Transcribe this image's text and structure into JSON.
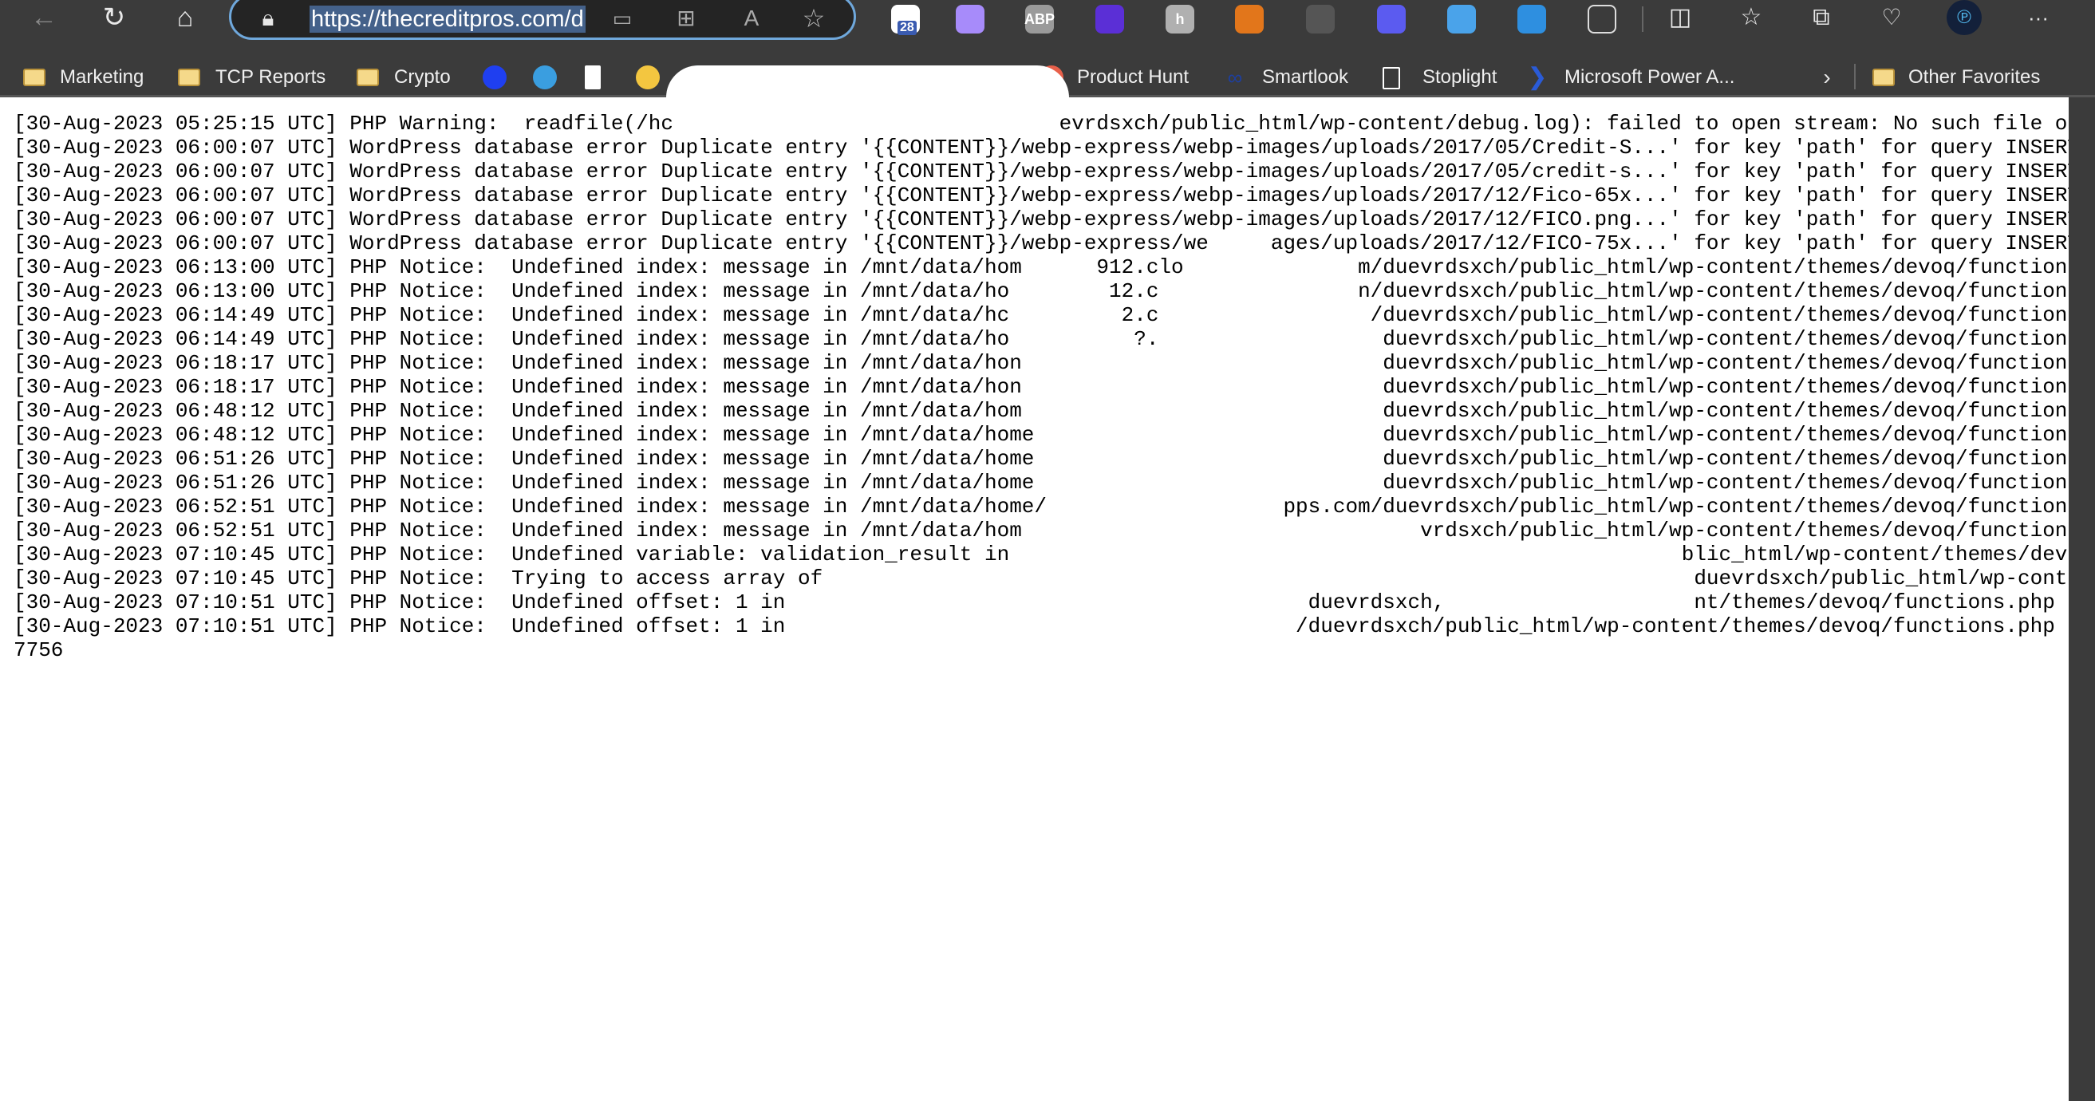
{
  "browser": {
    "url": "https://thecreditpros.com/d",
    "nav_icons": [
      "back-arrow-icon",
      "refresh-icon",
      "home-icon"
    ],
    "address_icons": [
      "lock-icon",
      "device-icon",
      "apps-icon",
      "read-aloud-icon",
      "star-icon"
    ],
    "extensions": [
      {
        "name": "calendar-icon",
        "badge": "28",
        "color": "#ffffff"
      },
      {
        "name": "ghost-icon",
        "color": "#a78bfa"
      },
      {
        "name": "adblock-plus-icon",
        "label": "ABP",
        "color": "#9a9a9a"
      },
      {
        "name": "purple-blocks-icon",
        "color": "#5b2fd6"
      },
      {
        "name": "h-icon",
        "label": "h",
        "color": "#b0b0b0"
      },
      {
        "name": "metamask-fox-icon",
        "color": "#e2761b"
      },
      {
        "name": "recycle-icon",
        "color": "#555555"
      },
      {
        "name": "blue-circle-icon",
        "color": "#5b5bf0"
      },
      {
        "name": "window-icon",
        "color": "#4aa3ea"
      },
      {
        "name": "salesforce-icon",
        "color": "#2e8fe0"
      },
      {
        "name": "puzzle-icon",
        "color": "#3b3b3b"
      }
    ],
    "right_icons": [
      "split-screen-icon",
      "favorites-icon",
      "collections-icon",
      "browser-health-icon",
      "profile-logo-icon",
      "more-icon"
    ],
    "more_label": "···"
  },
  "bookmarks": {
    "folders": [
      {
        "label": "Marketing"
      },
      {
        "label": "TCP Reports"
      },
      {
        "label": "Crypto"
      }
    ],
    "icon_links": [
      {
        "name": "bookmark-blue-circle-icon",
        "color": "#1f3ff0"
      },
      {
        "name": "bookmark-salesforce-icon",
        "color": "#3a9ee0"
      },
      {
        "name": "bookmark-t-icon",
        "color": "#ffffff"
      },
      {
        "name": "bookmark-gradient-icon",
        "color": "#f3c640"
      },
      {
        "name": "bookmark-snowflake-icon",
        "color": "#29b5e8"
      },
      {
        "name": "bookmark-bird-icon",
        "color": "#2a6fe0"
      },
      {
        "name": "bookmark-datadog-icon",
        "color": "#7b3fa0"
      },
      {
        "name": "bookmark-link-icon",
        "color": "#e8604a"
      },
      {
        "name": "bookmark-a-icon",
        "color": "#ffffff"
      }
    ],
    "links": [
      {
        "label": "Product Hunt",
        "icon": "product-hunt-icon",
        "color": "#e8604a"
      },
      {
        "label": "Smartlook",
        "icon": "smartlook-icon",
        "color": "#1d3fa0"
      },
      {
        "label": "Stoplight",
        "icon": "document-icon",
        "color": "#ffffff"
      },
      {
        "label": "Microsoft Power A...",
        "icon": "power-automate-icon",
        "color": "#2a5bd7"
      }
    ],
    "other_favorites": "Other Favorites"
  },
  "log": [
    {
      "l": "[30-Aug-2023 05:25:15 UTC] PHP Warning:  readfile(/hc",
      "r": "evrdsxch/public_html/wp-content/debug.log): failed to open stream: No such file or"
    },
    {
      "l": "[30-Aug-2023 06:00:07 UTC] WordPress database error Duplicate entry '{{CONTENT}}/webp-express/webp-images/uploads/2017/05/Credit-S...' for key 'path' for query INSERT"
    },
    {
      "l": "[30-Aug-2023 06:00:07 UTC] WordPress database error Duplicate entry '{{CONTENT}}/webp-express/webp-images/uploads/2017/05/credit-s...' for key 'path' for query INSERT"
    },
    {
      "l": "[30-Aug-2023 06:00:07 UTC] WordPress database error Duplicate entry '{{CONTENT}}/webp-express/webp-images/uploads/2017/12/Fico-65x...' for key 'path' for query INSERT"
    },
    {
      "l": "[30-Aug-2023 06:00:07 UTC] WordPress database error Duplicate entry '{{CONTENT}}/webp-express/webp-images/uploads/2017/12/FICO.png...' for key 'path' for query INSERT"
    },
    {
      "l": "[30-Aug-2023 06:00:07 UTC] WordPress database error Duplicate entry '{{CONTENT}}/webp-express/we",
      "r": "ages/uploads/2017/12/FICO-75x...' for key 'path' for query INSERT"
    },
    {
      "l": "[30-Aug-2023 06:13:00 UTC] PHP Notice:  Undefined index: message in /mnt/data/hom",
      "m": "912.clo",
      "r": "m/duevrdsxch/public_html/wp-content/themes/devoq/functions"
    },
    {
      "l": "[30-Aug-2023 06:13:00 UTC] PHP Notice:  Undefined index: message in /mnt/data/ho",
      "m": "12.c",
      "r": "n/duevrdsxch/public_html/wp-content/themes/devoq/functions"
    },
    {
      "l": "[30-Aug-2023 06:14:49 UTC] PHP Notice:  Undefined index: message in /mnt/data/hc",
      "m": "2.c",
      "r": "/duevrdsxch/public_html/wp-content/themes/devoq/functions"
    },
    {
      "l": "[30-Aug-2023 06:14:49 UTC] PHP Notice:  Undefined index: message in /mnt/data/ho",
      "m": "?.",
      "r": "duevrdsxch/public_html/wp-content/themes/devoq/functions"
    },
    {
      "l": "[30-Aug-2023 06:18:17 UTC] PHP Notice:  Undefined index: message in /mnt/data/hon",
      "r": "duevrdsxch/public_html/wp-content/themes/devoq/functions"
    },
    {
      "l": "[30-Aug-2023 06:18:17 UTC] PHP Notice:  Undefined index: message in /mnt/data/hon",
      "r": "duevrdsxch/public_html/wp-content/themes/devoq/functions"
    },
    {
      "l": "[30-Aug-2023 06:48:12 UTC] PHP Notice:  Undefined index: message in /mnt/data/hom",
      "r": "duevrdsxch/public_html/wp-content/themes/devoq/functions"
    },
    {
      "l": "[30-Aug-2023 06:48:12 UTC] PHP Notice:  Undefined index: message in /mnt/data/home",
      "r": "duevrdsxch/public_html/wp-content/themes/devoq/functions"
    },
    {
      "l": "[30-Aug-2023 06:51:26 UTC] PHP Notice:  Undefined index: message in /mnt/data/home",
      "r": "duevrdsxch/public_html/wp-content/themes/devoq/functions"
    },
    {
      "l": "[30-Aug-2023 06:51:26 UTC] PHP Notice:  Undefined index: message in /mnt/data/home",
      "r": "duevrdsxch/public_html/wp-content/themes/devoq/functions"
    },
    {
      "l": "[30-Aug-2023 06:52:51 UTC] PHP Notice:  Undefined index: message in /mnt/data/home/",
      "r": "pps.com/duevrdsxch/public_html/wp-content/themes/devoq/functions"
    },
    {
      "l": "[30-Aug-2023 06:52:51 UTC] PHP Notice:  Undefined index: message in /mnt/data/hom",
      "r": "vrdsxch/public_html/wp-content/themes/devoq/functions"
    },
    {
      "l": "[30-Aug-2023 07:10:45 UTC] PHP Notice:  Undefined variable: validation_result in",
      "r": "blic_html/wp-content/themes/devo"
    },
    {
      "l": "[30-Aug-2023 07:10:45 UTC] PHP Notice:  Trying to access array of",
      "r": "duevrdsxch/public_html/wp-conte"
    },
    {
      "l": "[30-Aug-2023 07:10:51 UTC] PHP Notice:  Undefined offset: 1 in",
      "m": "duevrdsxch,",
      "r": "nt/themes/devoq/functions.php ("
    },
    {
      "l": "[30-Aug-2023 07:10:51 UTC] PHP Notice:  Undefined offset: 1 in",
      "r": "/duevrdsxch/public_html/wp-content/themes/devoq/functions.php ("
    },
    {
      "l": "7756"
    }
  ]
}
